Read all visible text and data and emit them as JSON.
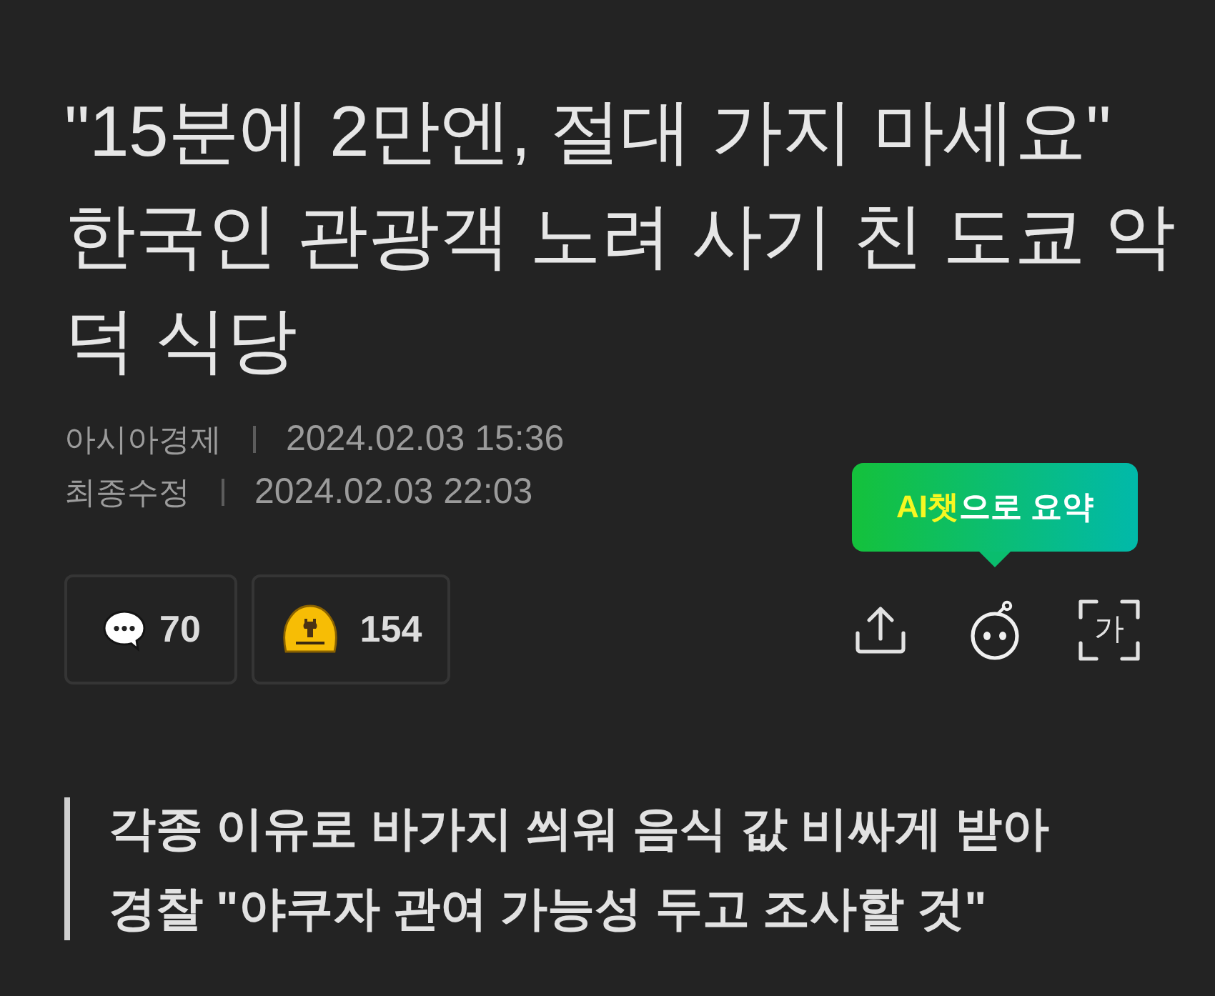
{
  "headline": "\"15분에 2만엔, 절대 가지 마세요\" 한국인 관광객 노려 사기 친 도쿄 악덕 식당",
  "meta": [
    {
      "label": "아시아경제",
      "datetime": "2024.02.03 15:36"
    },
    {
      "label": "최종수정",
      "datetime": "2024.02.03 22:03"
    }
  ],
  "reactions": [
    {
      "kind": "comment",
      "count": "70"
    },
    {
      "kind": "emoji",
      "count": "154"
    }
  ],
  "summary_tooltip": {
    "highlight": "AI챗",
    "text": "으로 요약"
  },
  "actions": [
    {
      "kind": "share"
    },
    {
      "kind": "chatbot"
    },
    {
      "kind": "translate",
      "label": "가"
    }
  ],
  "subheadline": [
    "각종 이유로 바가지 씌워 음식 값 비싸게 받아",
    "경찰 \"야쿠자 관여 가능성 두고 조사할 것\""
  ]
}
